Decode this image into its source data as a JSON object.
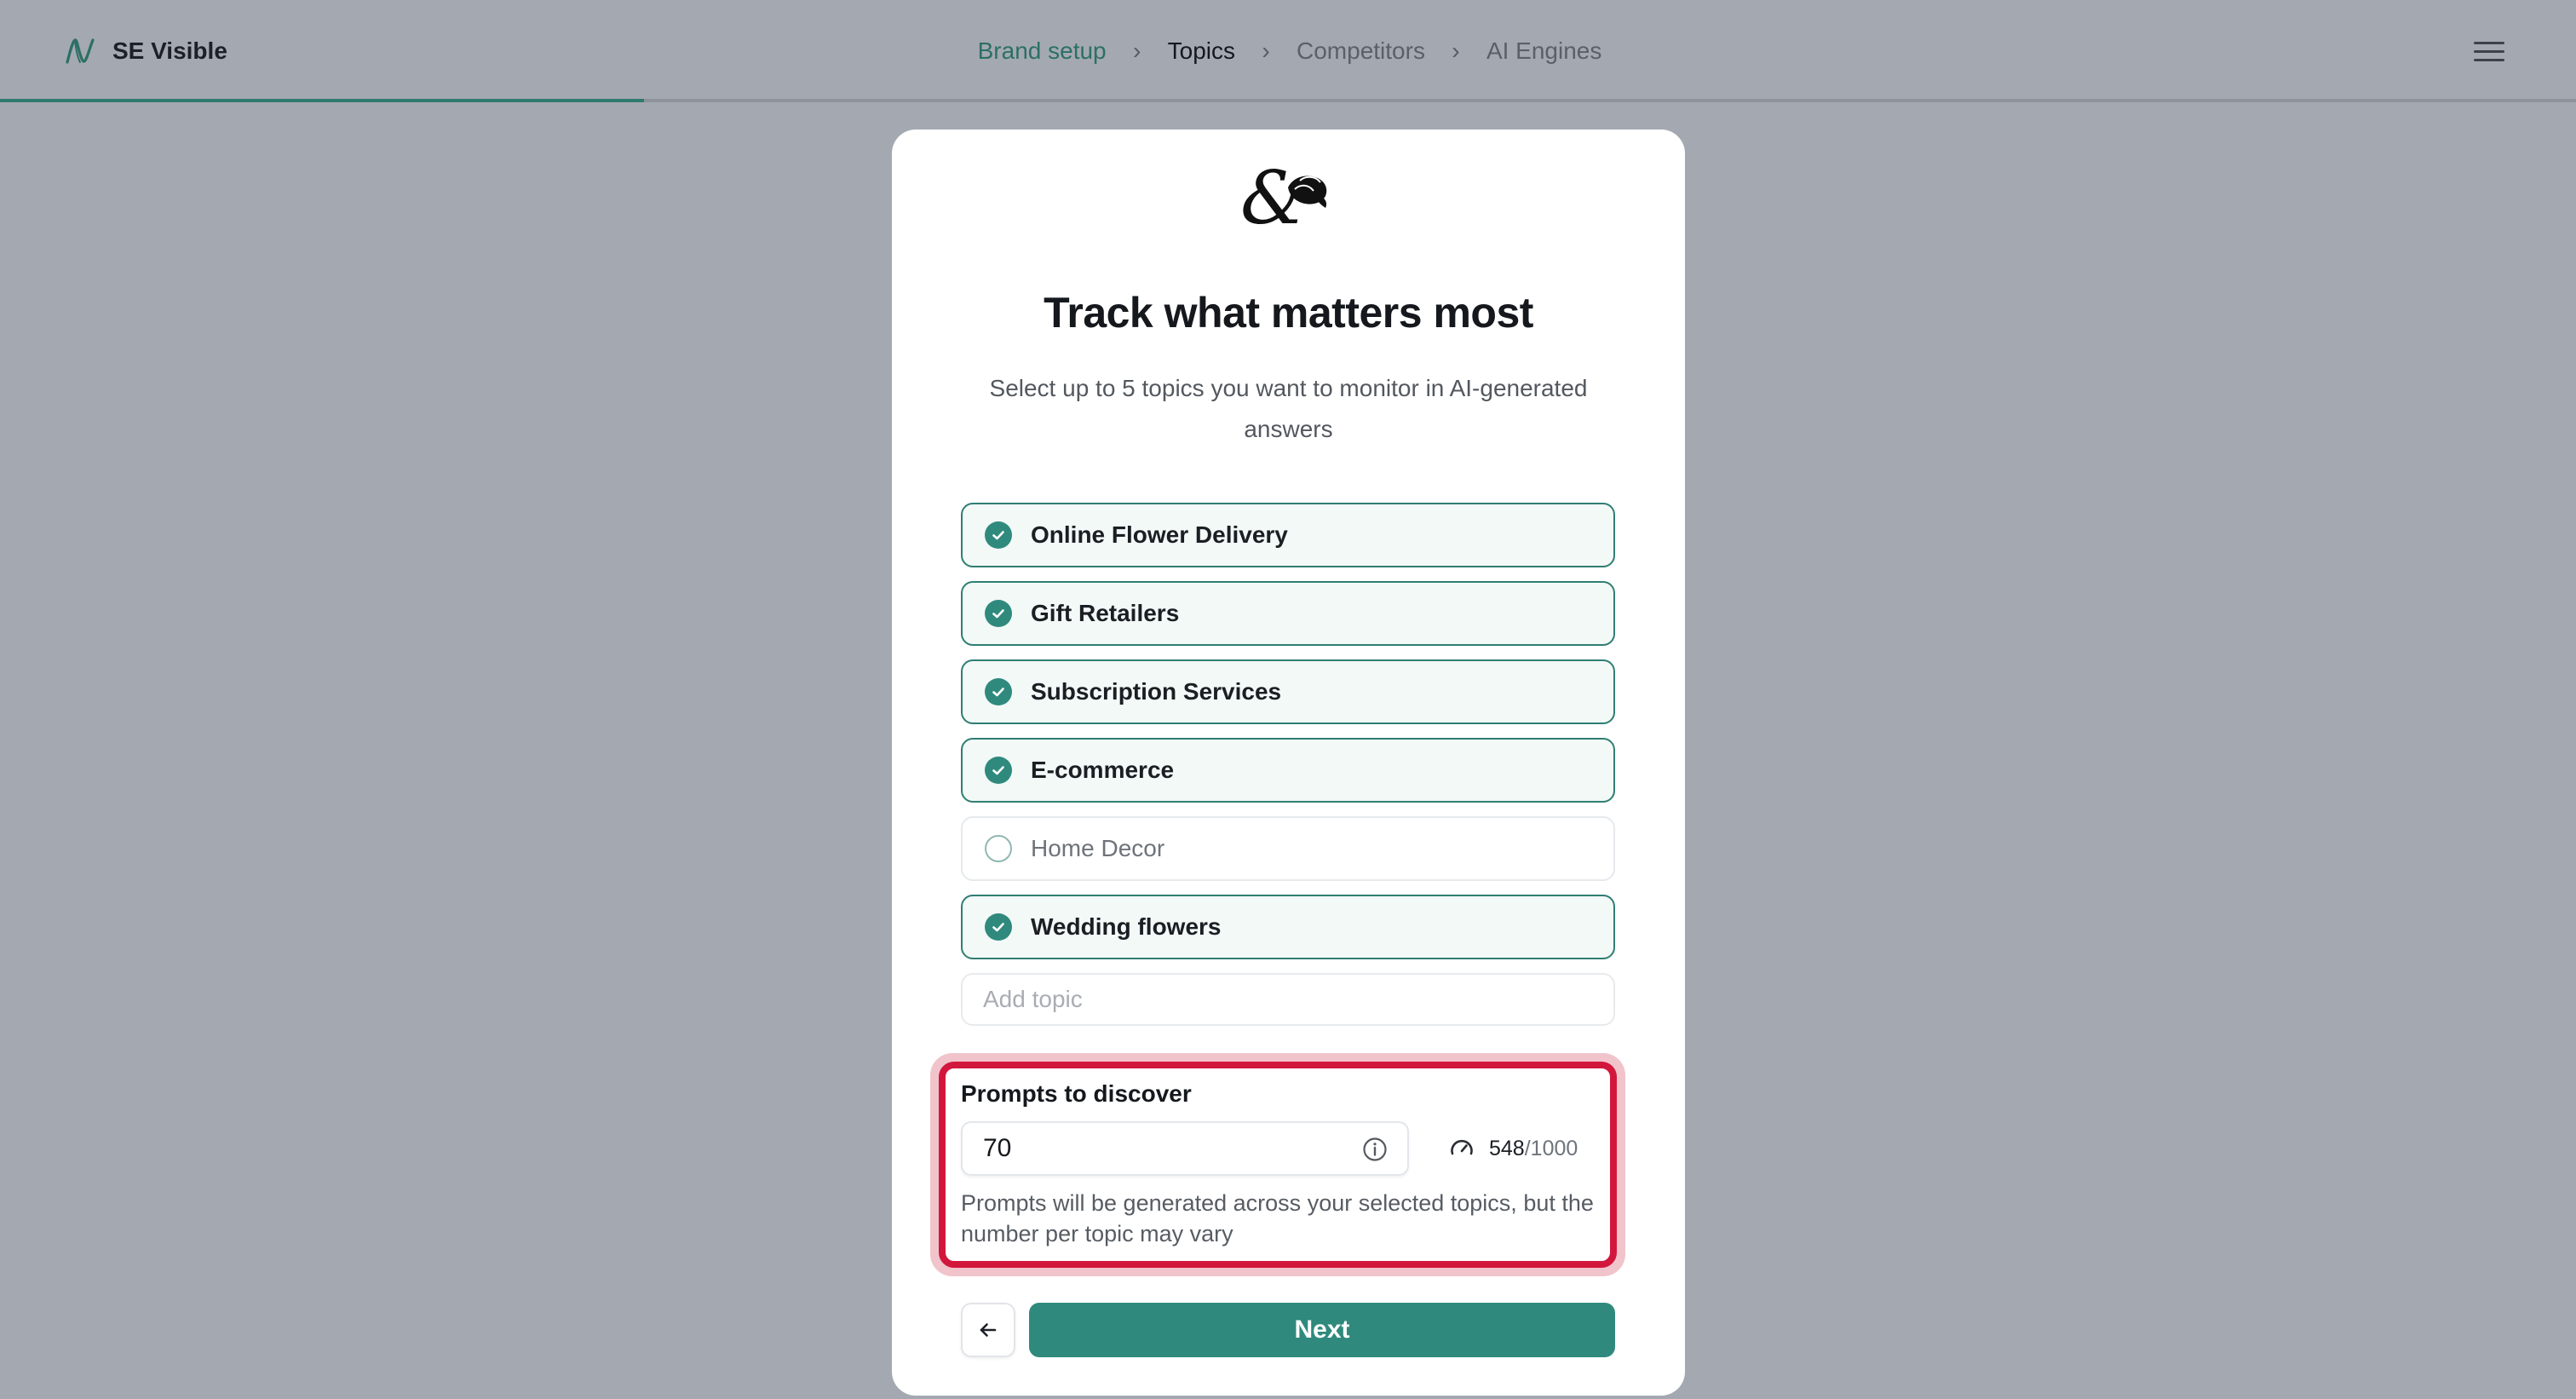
{
  "app": {
    "name": "SE Visible"
  },
  "breadcrumb": [
    {
      "label": "Brand setup",
      "state": "done"
    },
    {
      "label": "Topics",
      "state": "active"
    },
    {
      "label": "Competitors",
      "state": "pending"
    },
    {
      "label": "AI Engines",
      "state": "pending"
    }
  ],
  "onboarding_progress": 0.25,
  "card": {
    "title": "Track what matters most",
    "subtitle": "Select up to 5 topics you want to monitor in AI-generated answers"
  },
  "topics": [
    {
      "label": "Online Flower Delivery",
      "checked": true
    },
    {
      "label": "Gift Retailers",
      "checked": true
    },
    {
      "label": "Subscription Services",
      "checked": true
    },
    {
      "label": "E-commerce",
      "checked": true
    },
    {
      "label": "Home Decor",
      "checked": false
    },
    {
      "label": "Wedding flowers",
      "checked": true
    }
  ],
  "add_topic": {
    "placeholder": "Add topic",
    "value": ""
  },
  "prompts": {
    "label": "Prompts to discover",
    "value": "70",
    "used": "548",
    "total": "/1000",
    "help": "Prompts will be generated across your selected topics, but the number per topic may vary"
  },
  "actions": {
    "next_label": "Next"
  },
  "colors": {
    "accent": "#2f8a7d",
    "highlight": "#d2173c",
    "overlay": "#a4a9b1"
  },
  "icons": {
    "brand": "brand-logo-icon",
    "menu": "hamburger-menu-icon",
    "check": "check-icon",
    "info": "info-icon",
    "gauge": "gauge-icon",
    "back": "arrow-left-icon"
  }
}
